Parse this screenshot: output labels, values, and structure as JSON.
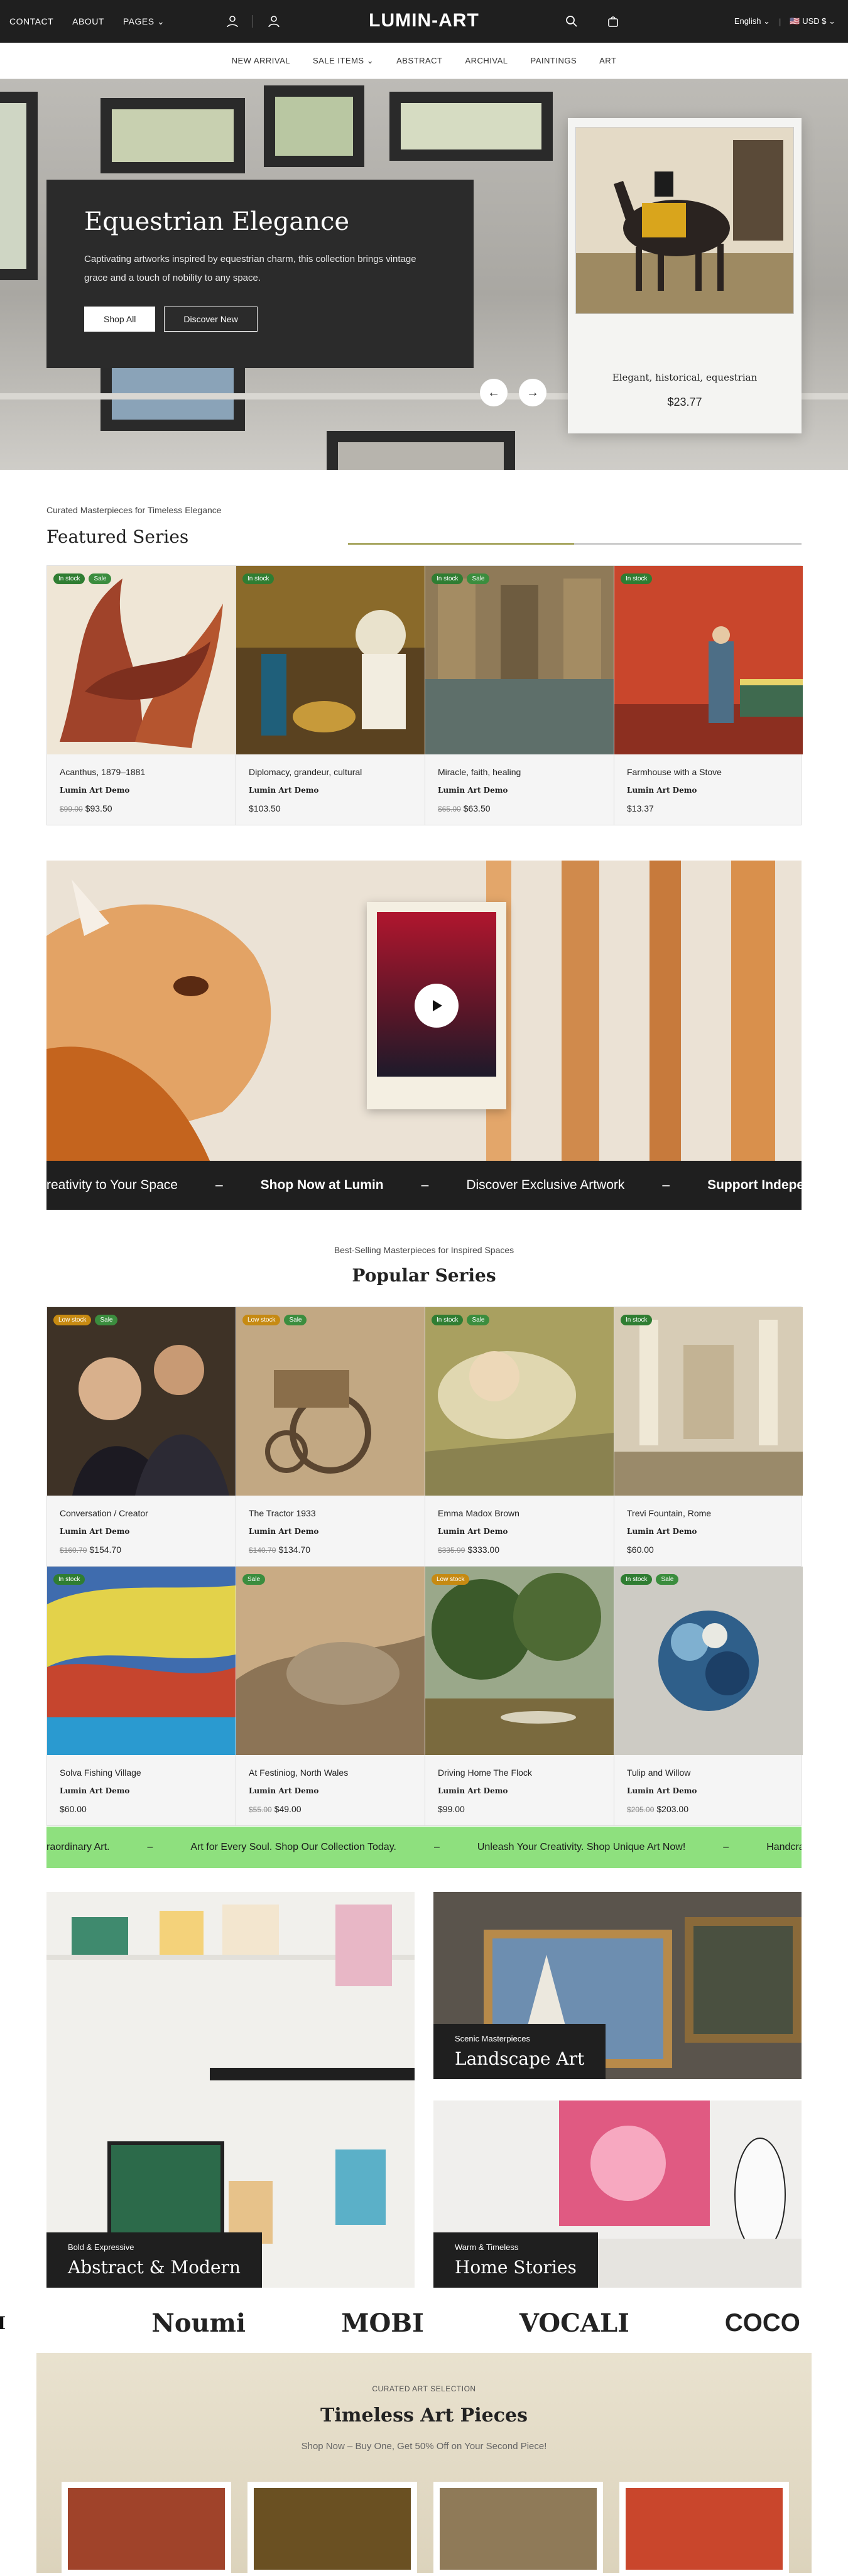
{
  "topbar": {
    "nav": [
      "CONTACT",
      "ABOUT",
      "PAGES"
    ],
    "logo": "LUMIN-ART",
    "language": "English",
    "currency": "USD $"
  },
  "menu": [
    "NEW ARRIVAL",
    "SALE ITEMS",
    "ABSTRACT",
    "ARCHIVAL",
    "PAINTINGS",
    "ART"
  ],
  "hero": {
    "title": "Equestrian Elegance",
    "description": "Captivating artworks inspired by equestrian charm, this collection brings vintage grace and a touch of nobility to any space.",
    "shop_all": "Shop All",
    "discover_new": "Discover New",
    "card_title": "Elegant, historical, equestrian",
    "card_price": "$23.77"
  },
  "featured": {
    "kicker": "Curated Masterpieces for Timeless Elegance",
    "title": "Featured Series",
    "products": [
      {
        "name": "Acanthus, 1879–1881",
        "vendor": "Lumin Art Demo",
        "old": "$99.00",
        "price": "$93.50",
        "badges": [
          "In stock",
          "Sale"
        ]
      },
      {
        "name": "Diplomacy, grandeur, cultural",
        "vendor": "Lumin Art Demo",
        "old": "",
        "price": "$103.50",
        "badges": [
          "In stock"
        ]
      },
      {
        "name": "Miracle, faith, healing",
        "vendor": "Lumin Art Demo",
        "old": "$65.00",
        "price": "$63.50",
        "badges": [
          "In stock",
          "Sale"
        ]
      },
      {
        "name": "Farmhouse with a Stove",
        "vendor": "Lumin Art Demo",
        "old": "",
        "price": "$13.37",
        "badges": [
          "In stock"
        ]
      }
    ]
  },
  "marquee1": [
    "reativity to Your Space",
    "–",
    "Shop Now at Lumin",
    "–",
    "Discover Exclusive Artwork",
    "–",
    "Support Independent Artist"
  ],
  "popular": {
    "kicker": "Best-Selling Masterpieces for Inspired Spaces",
    "title": "Popular Series",
    "row1": [
      {
        "name": "Conversation / Creator",
        "vendor": "Lumin Art Demo",
        "old": "$160.70",
        "price": "$154.70",
        "badges": [
          "Low stock",
          "Sale"
        ]
      },
      {
        "name": "The Tractor 1933",
        "vendor": "Lumin Art Demo",
        "old": "$140.70",
        "price": "$134.70",
        "badges": [
          "Low stock",
          "Sale"
        ]
      },
      {
        "name": "Emma Madox Brown",
        "vendor": "Lumin Art Demo",
        "old": "$335.99",
        "price": "$333.00",
        "badges": [
          "In stock",
          "Sale"
        ]
      },
      {
        "name": "Trevi Fountain, Rome",
        "vendor": "Lumin Art Demo",
        "old": "",
        "price": "$60.00",
        "badges": [
          "In stock"
        ]
      }
    ],
    "row2": [
      {
        "name": "Solva Fishing Village",
        "vendor": "Lumin Art Demo",
        "old": "",
        "price": "$60.00",
        "badges": [
          "In stock"
        ]
      },
      {
        "name": "At Festiniog, North Wales",
        "vendor": "Lumin Art Demo",
        "old": "$55.00",
        "price": "$49.00",
        "badges": [
          "Sale"
        ]
      },
      {
        "name": "Driving Home The Flock",
        "vendor": "Lumin Art Demo",
        "old": "",
        "price": "$99.00",
        "badges": [
          "Low stock"
        ]
      },
      {
        "name": "Tulip and Willow",
        "vendor": "Lumin Art Demo",
        "old": "$205.00",
        "price": "$203.00",
        "badges": [
          "In stock",
          "Sale"
        ]
      }
    ]
  },
  "marquee2": [
    "raordinary Art.",
    "–",
    "Art for Every Soul. Shop Our Collection Today.",
    "–",
    "Unleash Your Creativity. Shop Unique Art Now!",
    "–",
    "Handcraft"
  ],
  "categories": [
    {
      "kicker": "Bold & Expressive",
      "title": "Abstract & Modern"
    },
    {
      "kicker": "Scenic Masterpieces",
      "title": "Landscape Art"
    },
    {
      "kicker": "Warm & Timeless",
      "title": "Home Stories"
    }
  ],
  "brands": [
    "Noumi",
    "MOBI",
    "VOCALI",
    "COCO"
  ],
  "timeless": {
    "kicker": "CURATED ART SELECTION",
    "title": "Timeless Art Pieces",
    "subtitle": "Shop Now – Buy One, Get 50% Off on Your Second Piece!"
  },
  "colors": {
    "dark": "#1f1f1f",
    "accent_green": "#8ee07e",
    "badge_green": "#2f7d32",
    "badge_amber": "#c68a12",
    "line_olive": "#8b8a2e"
  }
}
